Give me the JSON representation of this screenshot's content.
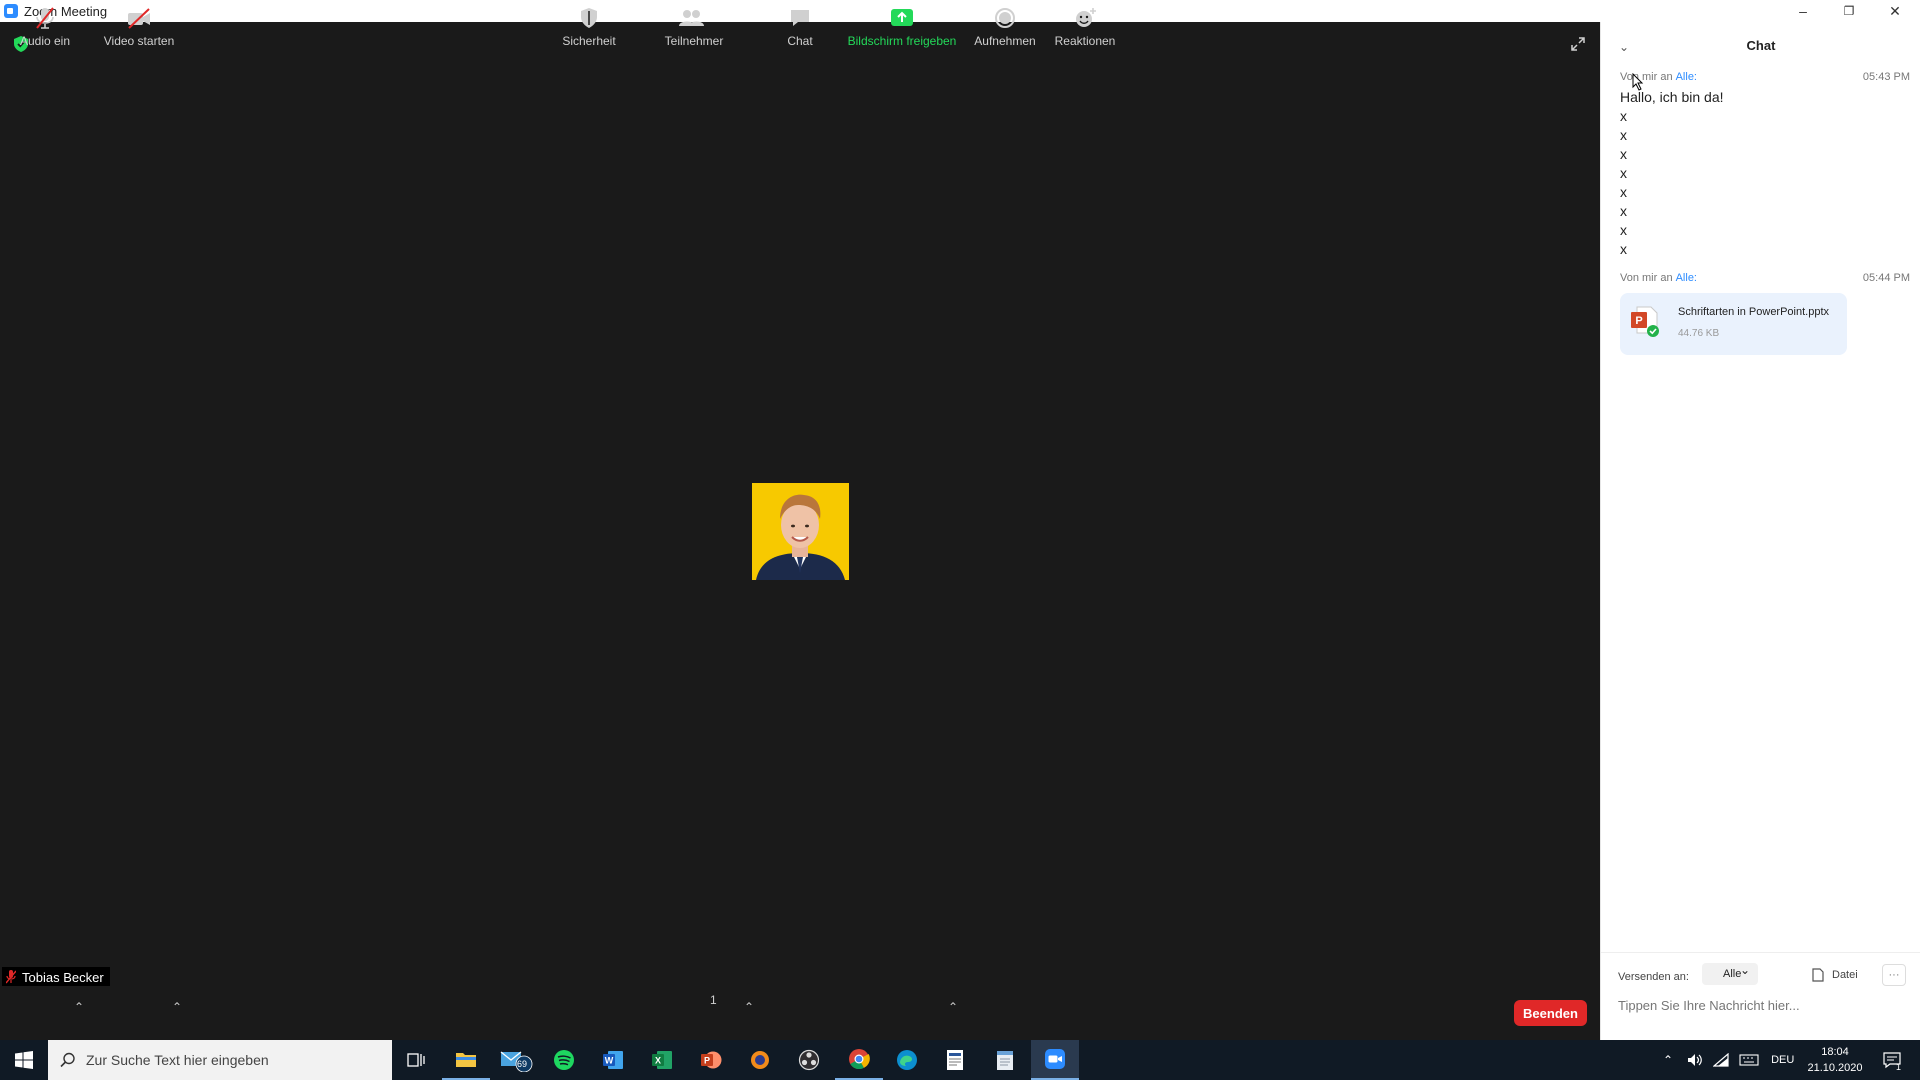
{
  "window": {
    "title": "Zoom Meeting",
    "min": "–",
    "max": "❐",
    "close": "✕"
  },
  "meeting": {
    "participant_name": "Tobias Becker",
    "accent_green": "#23d959",
    "end_color": "#e02828"
  },
  "toolbar": {
    "audio": "Audio ein",
    "video": "Video starten",
    "security": "Sicherheit",
    "participants": "Teilnehmer",
    "participants_count": "1",
    "chat": "Chat",
    "share": "Bildschirm freigeben",
    "record": "Aufnehmen",
    "reactions": "Reaktionen",
    "end": "Beenden"
  },
  "chat": {
    "title": "Chat",
    "messages": [
      {
        "from": "Von mir an",
        "to": "Alle:",
        "time": "05:43 PM",
        "lines": [
          "Hallo, ich bin da!",
          "x",
          "x",
          "x",
          "x",
          "x",
          "x",
          "x",
          "x"
        ]
      },
      {
        "from": "Von mir an",
        "to": "Alle:",
        "time": "05:44 PM",
        "file": {
          "name": "Schriftarten in PowerPoint.pptx",
          "size": "44.76 KB"
        }
      }
    ],
    "send_to_label": "Versenden an:",
    "recipient": "Alle",
    "file_button": "Datei",
    "more": "···",
    "input_placeholder": "Tippen Sie Ihre Nachricht hier..."
  },
  "taskbar": {
    "search_placeholder": "Zur Suche Text hier eingeben",
    "mail_badge": "69",
    "language": "DEU",
    "time": "18:04",
    "date": "21.10.2020",
    "notification_count": "1"
  }
}
